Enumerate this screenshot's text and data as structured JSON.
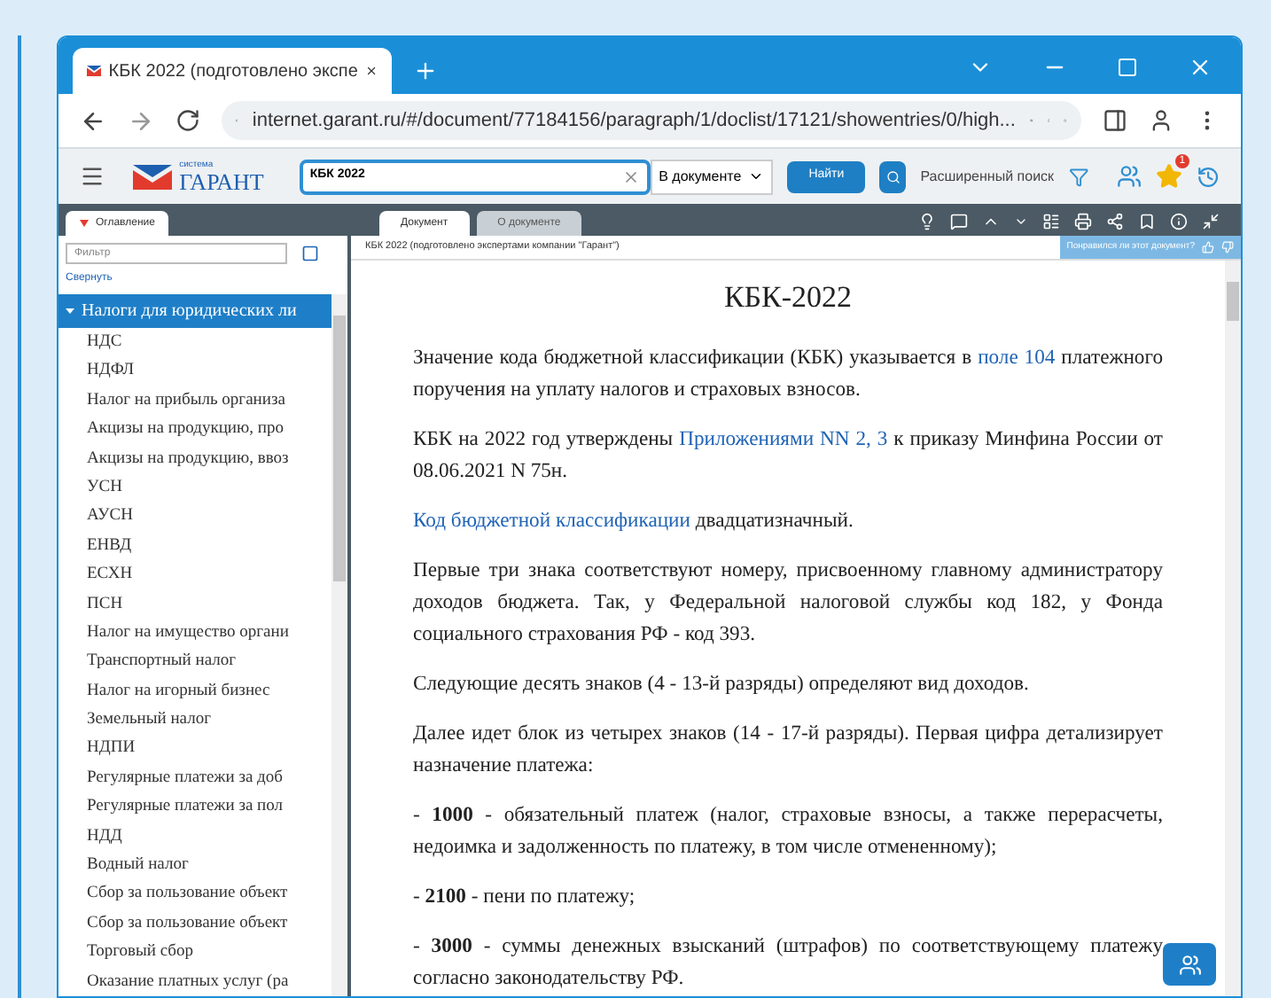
{
  "browser": {
    "tab_title": "КБК 2022 (подготовлено экспе",
    "url": "internet.garant.ru/#/document/77184156/paragraph/1/doclist/17121/showentries/0/high..."
  },
  "toolbar": {
    "logo_small": "система",
    "logo": "ГАРАНТ",
    "search_value": "КБК 2022",
    "scope": "В документе",
    "find_button": "Найти",
    "advanced_search": "Расширенный поиск",
    "favorites_badge": "1"
  },
  "panel_tabs": [
    {
      "label": "Оглавление",
      "selected": true
    }
  ],
  "doc_tabs": [
    {
      "label": "Документ",
      "selected": true
    },
    {
      "label": "О документе",
      "selected": false
    }
  ],
  "sidebar": {
    "filter_placeholder": "Фильтр",
    "collapse_link": "Свернуть",
    "items": [
      {
        "label": "Налоги для юридических ли",
        "selected": true,
        "expanded": true,
        "children": [
          {
            "label": "НДС",
            "selected": false
          },
          {
            "label": "НДФЛ",
            "selected": false
          },
          {
            "label": "Налог на прибыль организа",
            "selected": false
          },
          {
            "label": "Акцизы на продукцию, про",
            "selected": false
          },
          {
            "label": "Акцизы на продукцию, ввоз",
            "selected": false
          },
          {
            "label": "УСН",
            "selected": false
          },
          {
            "label": "АУСН",
            "selected": false
          },
          {
            "label": "ЕНВД",
            "selected": false
          },
          {
            "label": "ЕСХН",
            "selected": false
          },
          {
            "label": "ПСН",
            "selected": false
          },
          {
            "label": "Налог на имущество органи",
            "selected": false
          },
          {
            "label": "Транспортный налог",
            "selected": false
          },
          {
            "label": "Налог на игорный бизнес",
            "selected": false
          },
          {
            "label": "Земельный налог",
            "selected": false
          },
          {
            "label": "НДПИ",
            "selected": false
          },
          {
            "label": "Регулярные платежи за доб",
            "selected": false
          },
          {
            "label": "Регулярные платежи за пол",
            "selected": false
          },
          {
            "label": "НДД",
            "selected": false
          },
          {
            "label": "Водный налог",
            "selected": false
          },
          {
            "label": "Сбор за пользование объект",
            "selected": false
          },
          {
            "label": "Сбор за пользование объект",
            "selected": false
          },
          {
            "label": "Торговый сбор",
            "selected": false
          },
          {
            "label": "Оказание платных услуг (ра",
            "selected": false
          }
        ]
      }
    ]
  },
  "document": {
    "header": "КБК 2022 (подготовлено экспертами компании \"Гарант\")",
    "feedback": "Понравился ли этот документ?",
    "title": "КБК-2022",
    "paragraphs": [
      {
        "parts": [
          {
            "kind": "plain",
            "text": "Значение кода бюджетной классификации (КБК) указывается в"
          },
          {
            "kind": "link",
            "text": "поле 104"
          },
          {
            "kind": "plain",
            "text": "платежного поручения на уплату налогов и страховых взносов."
          }
        ]
      },
      {
        "parts": [
          {
            "kind": "plain",
            "text": "КБК на 2022 год утверждены"
          },
          {
            "kind": "link",
            "text": "Приложениями NN 2, 3"
          },
          {
            "kind": "plain",
            "text": "к приказу Минфина России от 08.06.2021 N 75н."
          }
        ]
      },
      {
        "parts": [
          {
            "kind": "link",
            "text": "Код бюджетной классификации"
          },
          {
            "kind": "plain",
            "text": "двадцатизначный."
          }
        ]
      },
      {
        "parts": [
          {
            "kind": "plain",
            "text": "Первые три знака соответствуют номеру, присвоенному главному администратору доходов бюджета. Так, у Федеральной налоговой службы код 182, у Фонда социального страхования РФ - код 393."
          }
        ]
      },
      {
        "parts": [
          {
            "kind": "plain",
            "text": "Следующие десять знаков (4 - 13-й разряды) определяют вид доходов."
          }
        ]
      },
      {
        "parts": [
          {
            "kind": "plain",
            "text": "Далее идет блок из четырех знаков (14 - 17-й разряды). Первая цифра детализирует назначение платежа:"
          }
        ]
      },
      {
        "parts": [
          {
            "kind": "plain",
            "text": "- **1000** - обязательный платеж (налог, страховые взносы, а также перерасчеты, недоимка и задолженность по платежу, в том числе отмененному);"
          }
        ]
      },
      {
        "parts": [
          {
            "kind": "plain",
            "text": "- **2100** - пени по платежу;"
          }
        ]
      },
      {
        "parts": [
          {
            "kind": "plain",
            "text": "- **3000** - суммы денежных взысканий (штрафов) по соответствующему платежу согласно законодательству РФ."
          }
        ]
      }
    ]
  }
}
